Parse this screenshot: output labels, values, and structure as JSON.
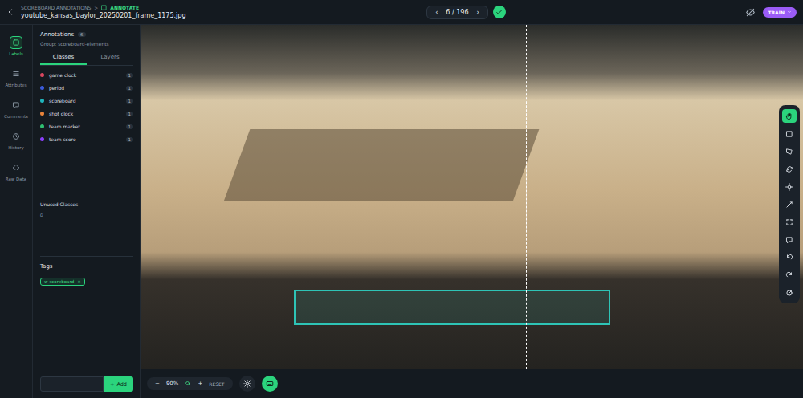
{
  "breadcrumb": {
    "parent": "SCOREBOARD ANNOTATIONS",
    "separator": ">",
    "current": "ANNOTATE"
  },
  "file": {
    "name": "youtube_kansas_baylor_20250201_frame_1175.jpg"
  },
  "pager": {
    "prev": "‹",
    "position": "6 / 196",
    "next": "›"
  },
  "mode": {
    "label": "TRAIN"
  },
  "rail": [
    {
      "label": "Labels",
      "selected": true
    },
    {
      "label": "Attributes",
      "selected": false
    },
    {
      "label": "Comments",
      "selected": false
    },
    {
      "label": "History",
      "selected": false
    },
    {
      "label": "Raw Data",
      "selected": false
    }
  ],
  "annotations": {
    "title": "Annotations",
    "count": "6",
    "group": "Group: scoreboard-elements"
  },
  "tabs": [
    {
      "label": "Classes",
      "selected": true
    },
    {
      "label": "Layers",
      "selected": false
    }
  ],
  "classes": [
    {
      "name": "game clock",
      "count": "1",
      "color": "#d9465f"
    },
    {
      "name": "period",
      "count": "1",
      "color": "#3b5bdb"
    },
    {
      "name": "scoreboard",
      "count": "1",
      "color": "#1fb5bd"
    },
    {
      "name": "shot clock",
      "count": "1",
      "color": "#e8833a"
    },
    {
      "name": "team market",
      "count": "1",
      "color": "#2fbf71"
    },
    {
      "name": "team score",
      "count": "1",
      "color": "#8a3ffc"
    }
  ],
  "unused": {
    "title": "Unused Classes",
    "count": "0"
  },
  "tags": {
    "title": "Tags",
    "items": [
      {
        "label": "w-scoreboard",
        "remove": "×"
      }
    ]
  },
  "add": {
    "icon": "+",
    "label": "Add"
  },
  "zoom": {
    "minus": "−",
    "value": "90%",
    "plus": "+",
    "reset": "RESET"
  },
  "tools": [
    {
      "selected": true
    },
    {
      "selected": false
    },
    {
      "selected": false
    },
    {
      "selected": false
    },
    {
      "selected": false
    },
    {
      "selected": false
    },
    {
      "selected": false
    },
    {
      "selected": false
    },
    {
      "selected": false
    },
    {
      "selected": false
    },
    {
      "selected": false
    }
  ]
}
